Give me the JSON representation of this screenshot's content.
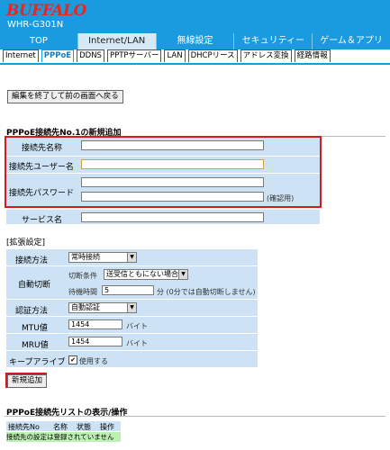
{
  "brand": {
    "logo": "BUFFALO",
    "model": "WHR-G301N"
  },
  "tabs": [
    {
      "label": "TOP"
    },
    {
      "label": "Internet/LAN"
    },
    {
      "label": "無線設定"
    },
    {
      "label": "セキュリティー"
    },
    {
      "label": "ゲーム＆アプリ"
    }
  ],
  "subtabs": [
    {
      "label": "Internet"
    },
    {
      "label": "PPPoE"
    },
    {
      "label": "DDNS"
    },
    {
      "label": "PPTPサーバー"
    },
    {
      "label": "LAN"
    },
    {
      "label": "DHCPリース"
    },
    {
      "label": "アドレス変換"
    },
    {
      "label": "経路情報"
    }
  ],
  "back_button": "編集を終了して前の画面へ戻る",
  "section1": {
    "title": "PPPoE接続先No.1の新規追加",
    "conn_name_label": "接続先名称",
    "user_label": "接続先ユーザー名",
    "password_label": "接続先パスワード",
    "confirm_note": "(確認用)",
    "service_label": "サービス名"
  },
  "section2": {
    "title": "[拡張設定]",
    "method_label": "接続方法",
    "method_value": "常時接続",
    "auto_label": "自動切断",
    "cond_label": "切断条件",
    "cond_value": "送受信ともにない場合",
    "wait_label": "待機時間",
    "wait_value": "5",
    "wait_unit": "分 (0分では自動切断しません)",
    "auth_label": "認証方法",
    "auth_value": "自動認証",
    "mtu_label": "MTU値",
    "mtu_value": "1454",
    "mtu_unit": "バイト",
    "mru_label": "MRU値",
    "mru_value": "1454",
    "mru_unit": "バイト",
    "keepalive_label": "キープアライブ",
    "keepalive_check": "使用する",
    "keepalive_checked": true
  },
  "new_button": "新規追加",
  "section3": {
    "title": "PPPoE接続先リストの表示/操作",
    "columns": [
      "接続先No",
      "名称",
      "状態",
      "操作"
    ],
    "empty_message": "接続先の設定は登録されていません"
  }
}
